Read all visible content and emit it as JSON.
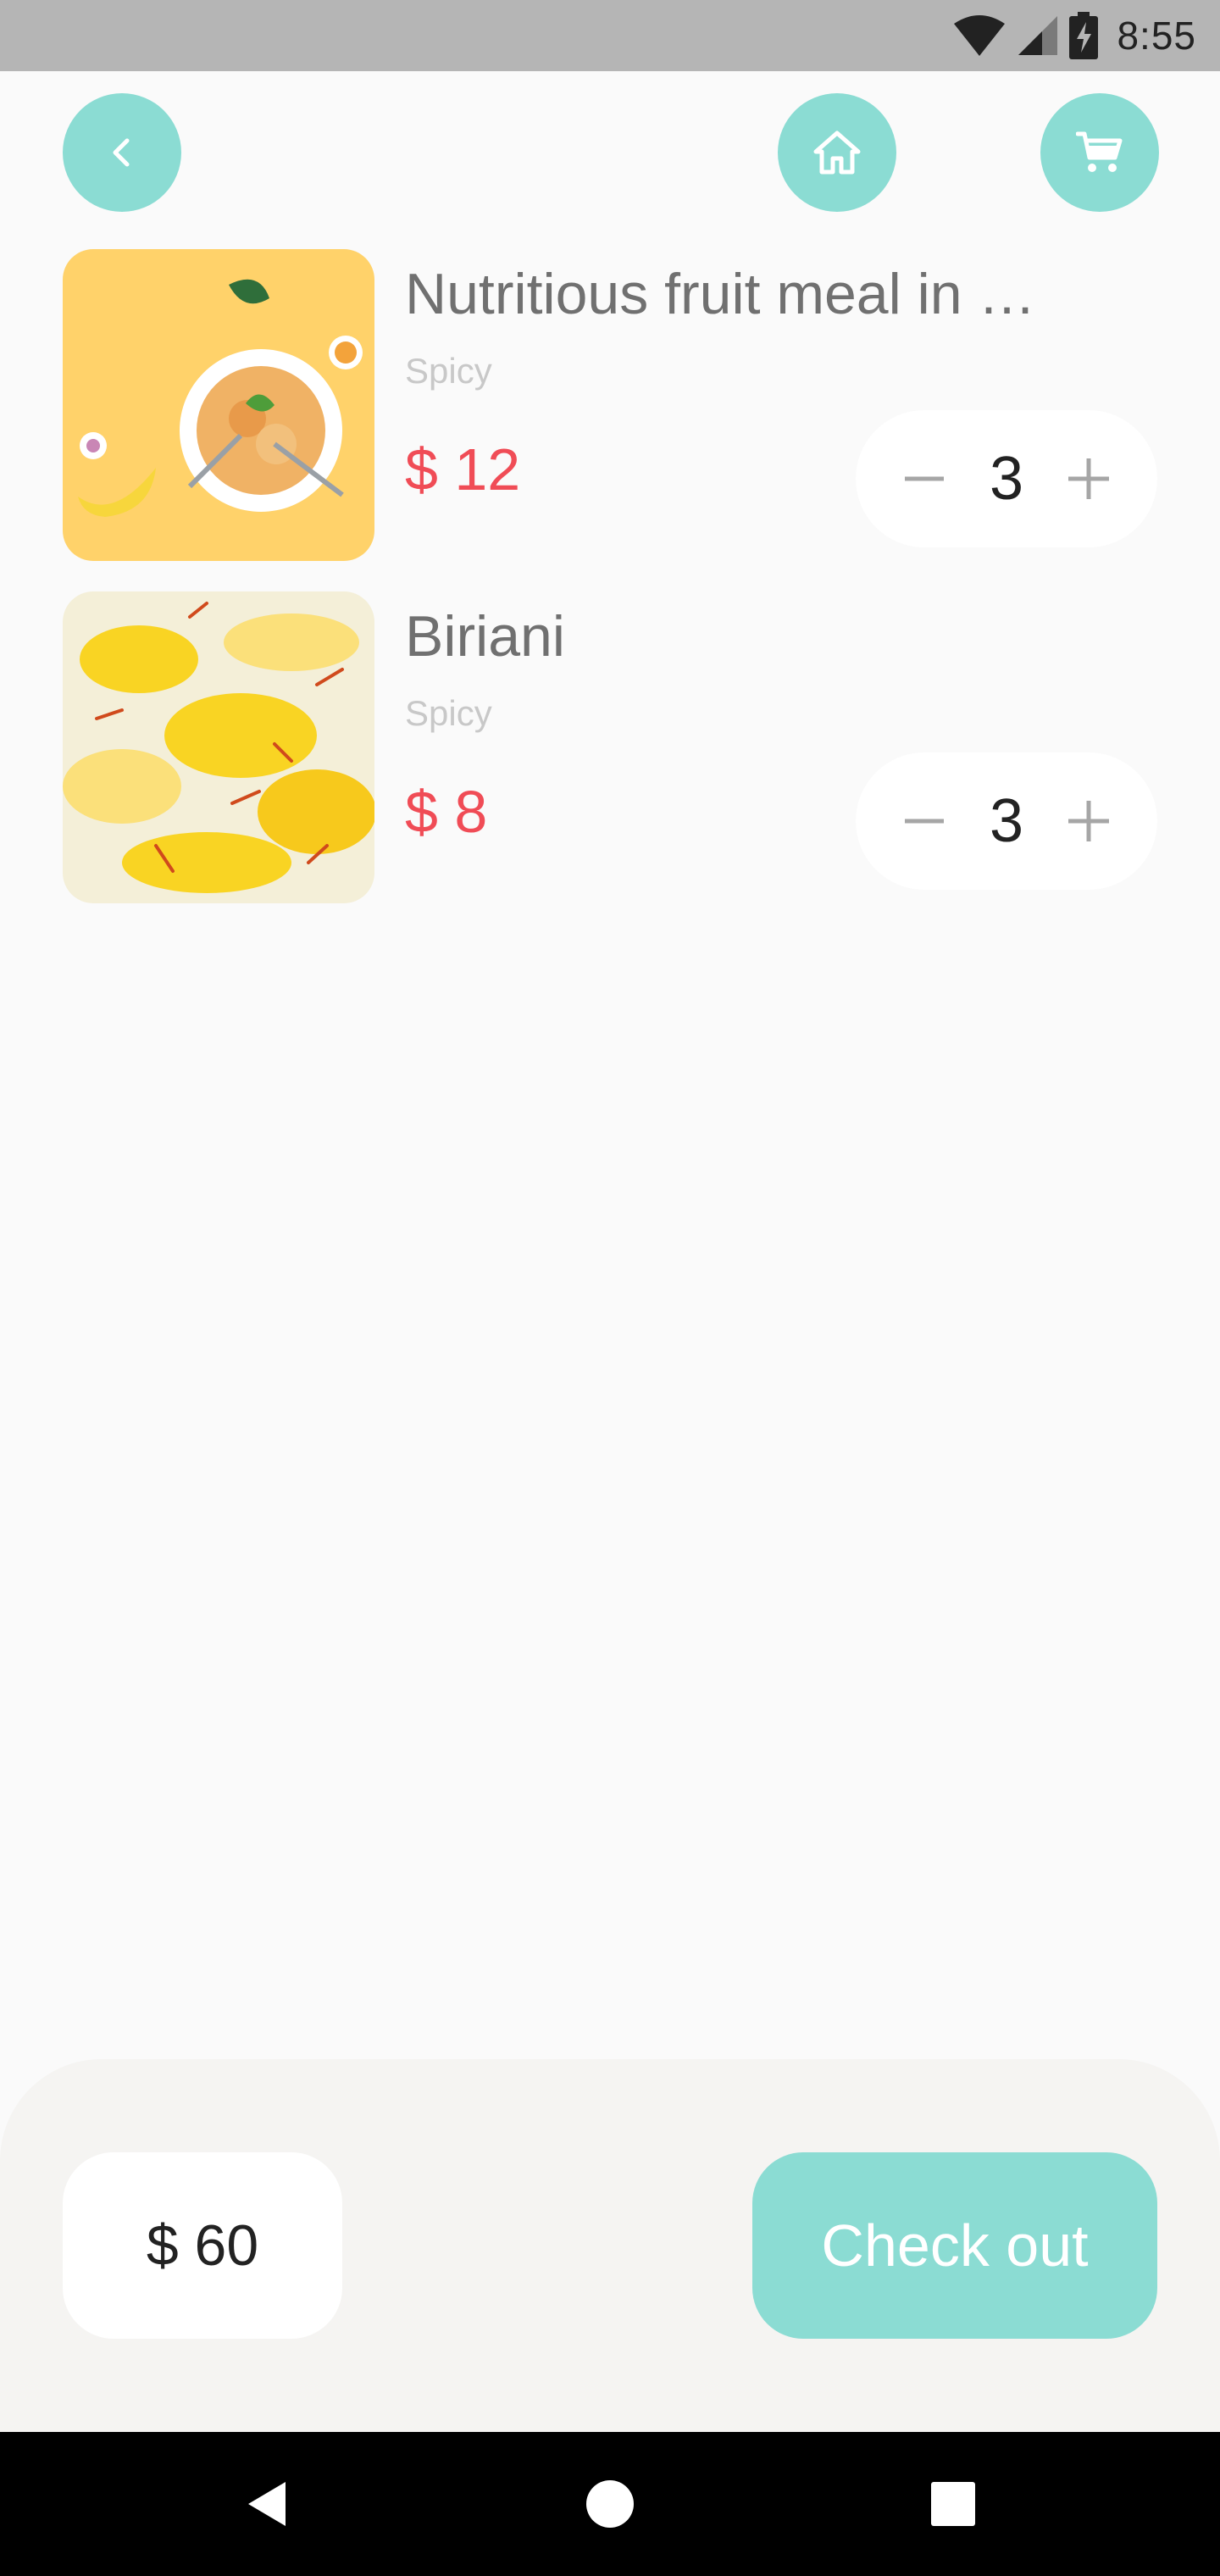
{
  "status_bar": {
    "time": "8:55"
  },
  "toolbar": {
    "back_icon": "chevron-left-icon",
    "home_icon": "home-icon",
    "cart_icon": "cart-icon",
    "accent_color": "#8bdcd3"
  },
  "cart": {
    "items": [
      {
        "title": "Nutritious fruit meal in …",
        "subtitle": "Spicy",
        "price": "$ 12",
        "quantity": "3"
      },
      {
        "title": "Biriani",
        "subtitle": "Spicy",
        "price": "$ 8",
        "quantity": "3"
      }
    ],
    "price_color": "#f04c56"
  },
  "footer": {
    "total": "$ 60",
    "checkout_label": "Check out"
  }
}
